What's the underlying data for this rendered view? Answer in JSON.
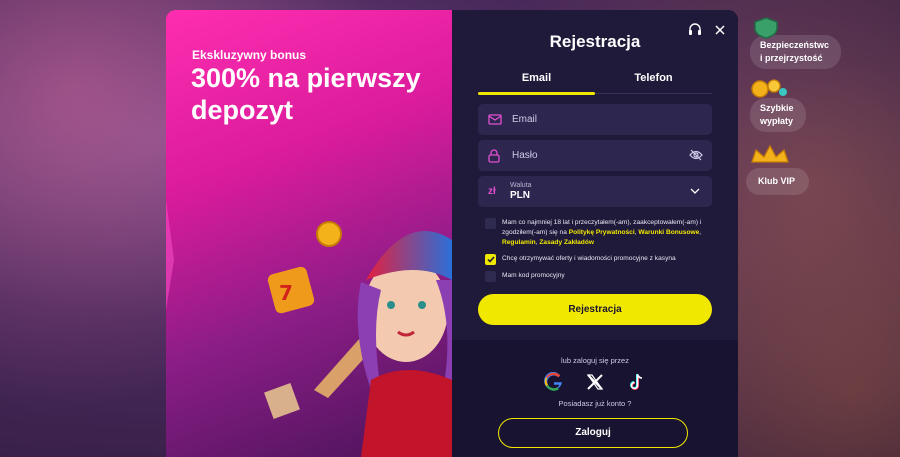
{
  "promo": {
    "eyebrow": "Ekskluzywny bonus",
    "headline": "300% na pierwszy depozyt"
  },
  "form": {
    "title": "Rejestracja",
    "tabs": [
      {
        "label": "Email",
        "active": true
      },
      {
        "label": "Telefon",
        "active": false
      }
    ],
    "email_placeholder": "Email",
    "password_placeholder": "Hasło",
    "currency": {
      "symbol": "zł",
      "label": "Waluta",
      "value": "PLN"
    },
    "consent": {
      "text_before": "Mam co najmniej 18 lat i przeczytałem(-am), zaakceptowałem(-am) i zgodziłem(-am) się na ",
      "link1": "Politykę Prywatności",
      "sep1": ", ",
      "link2": "Warunki Bonusowe",
      "sep2": ", ",
      "link3": "Regulamin",
      "sep3": ", ",
      "link4": "Zasady Zakładów",
      "checked": false
    },
    "offers": {
      "text": "Chcę otrzymywać oferty i wiadomości promocyjne z kasyna",
      "checked": true
    },
    "promo_code": {
      "text": "Mam kod promocyjny",
      "checked": false
    },
    "register_button": "Rejestracja",
    "alt_login": "lub zaloguj się przez",
    "socials": [
      "google-icon",
      "x-icon",
      "tiktok-icon"
    ],
    "have_account": "Posiadasz już konto ?",
    "login_button": "Zaloguj"
  },
  "sidebar": {
    "items": [
      {
        "label": "Bezpieczeństwo i przejrzystość",
        "line1": "Bezpieczeństwc",
        "line2": "i przejrzystość",
        "icon": "shield-icon"
      },
      {
        "label": "Szybkie wypłaty",
        "line1": "Szybkie",
        "line2": "wypłaty",
        "icon": "coins-icon"
      },
      {
        "label": "Klub VIP",
        "line1": "Klub VIP",
        "line2": "",
        "icon": "crown-icon"
      }
    ]
  },
  "colors": {
    "accent": "#f1e800",
    "panel": "#1f1a3a",
    "promo_pink": "#ff2db0"
  }
}
